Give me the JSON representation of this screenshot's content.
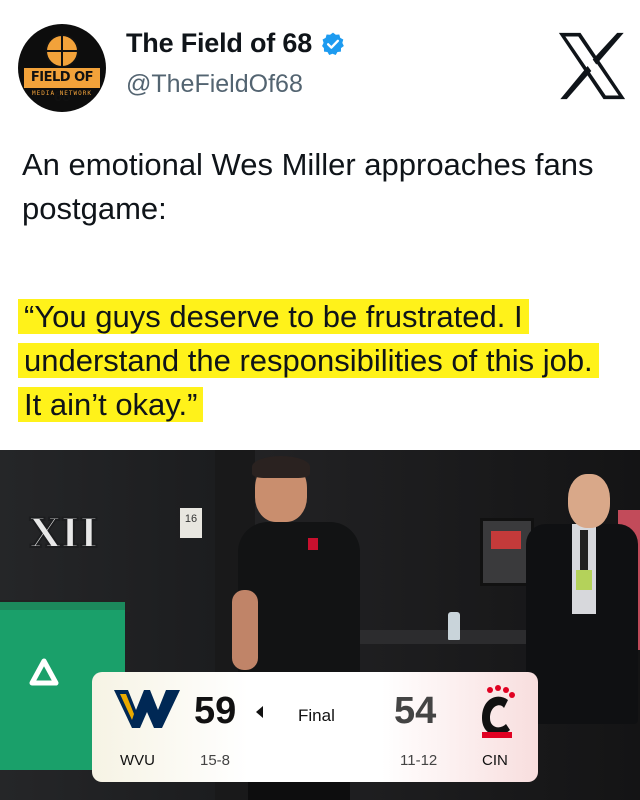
{
  "author": {
    "display_name": "The Field of 68",
    "handle": "@TheFieldOf68",
    "verified_icon": "verified-badge-icon",
    "avatar": {
      "logo_text": "FIELD OF 68",
      "logo_sub": "MEDIA NETWORK"
    }
  },
  "platform_logo": "x-logo-icon",
  "tweet": {
    "text": "An emotional Wes Miller approaches fans postgame:",
    "highlighted_quote": "“You guys deserve to be frustrated. I understand the responsibilities of this job. It ain’t okay.”"
  },
  "media": {
    "wall_sign": "XII",
    "door_sign": "16",
    "scoreboard": {
      "home": {
        "abbr": "WVU",
        "score": "59",
        "record": "15-8"
      },
      "status": "Final",
      "away": {
        "abbr": "CIN",
        "score": "54",
        "record": "11-12"
      }
    }
  },
  "colors": {
    "highlight": "#fff21a",
    "verified": "#1d9bf0",
    "handle_gray": "#536471",
    "wvu_navy": "#002855",
    "wvu_gold": "#eaaa00",
    "cin_red": "#e00122"
  }
}
